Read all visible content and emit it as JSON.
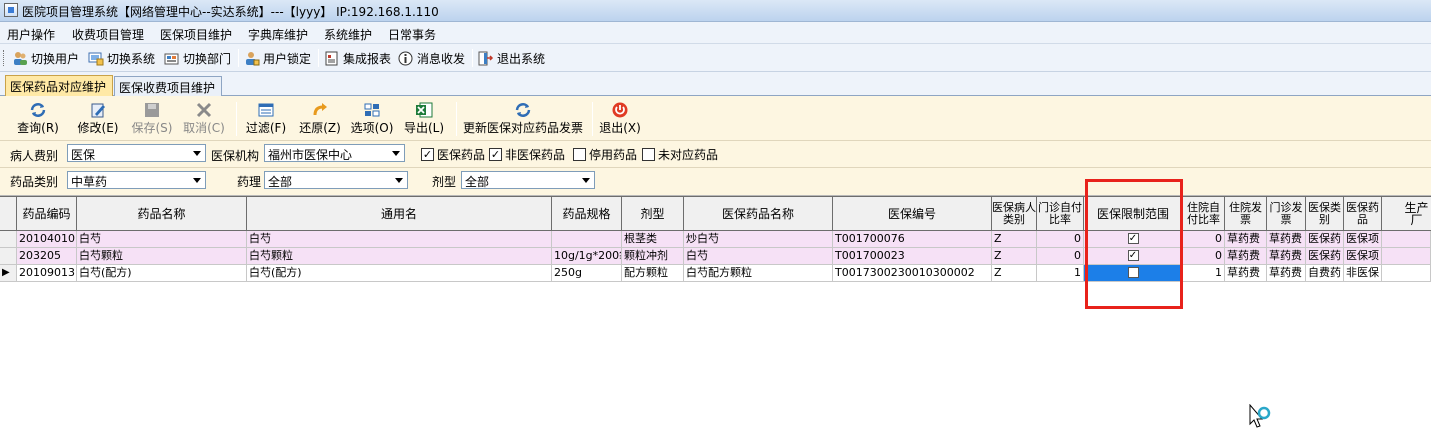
{
  "window": {
    "title": "医院项目管理系统【网络管理中心--实达系统】---【lyyy】 IP:192.168.1.110"
  },
  "menu": [
    "用户操作",
    "收费项目管理",
    "医保项目维护",
    "字典库维护",
    "系统维护",
    "日常事务"
  ],
  "toolbar": [
    {
      "label": "切换用户",
      "icon": "users-icon"
    },
    {
      "label": "切换系统",
      "icon": "switch-system-icon"
    },
    {
      "label": "切换部门",
      "icon": "department-icon"
    },
    {
      "label": "用户锁定",
      "icon": "lock-user-icon"
    },
    {
      "label": "集成报表",
      "icon": "report-icon"
    },
    {
      "label": "消息收发",
      "icon": "info-icon"
    },
    {
      "label": "退出系统",
      "icon": "exit-icon"
    }
  ],
  "tabs": [
    "医保药品对应维护",
    "医保收费项目维护"
  ],
  "actions": [
    {
      "label": "查询(R)",
      "icon": "refresh-icon",
      "enabled": true
    },
    {
      "label": "修改(E)",
      "icon": "edit-icon",
      "enabled": true
    },
    {
      "label": "保存(S)",
      "icon": "save-icon",
      "enabled": false
    },
    {
      "label": "取消(C)",
      "icon": "cancel-icon",
      "enabled": false
    },
    {
      "label": "过滤(F)",
      "icon": "filter-icon",
      "enabled": true
    },
    {
      "label": "还原(Z)",
      "icon": "restore-icon",
      "enabled": true
    },
    {
      "label": "选项(O)",
      "icon": "options-icon",
      "enabled": true
    },
    {
      "label": "导出(L)",
      "icon": "excel-icon",
      "enabled": true
    },
    {
      "label": "更新医保对应药品发票",
      "icon": "update-icon",
      "enabled": true
    },
    {
      "label": "退出(X)",
      "icon": "power-icon",
      "enabled": true
    }
  ],
  "filters": {
    "patient_type_label": "病人费别",
    "patient_type_value": "医保",
    "institution_label": "医保机构",
    "institution_value": "福州市医保中心",
    "checks": [
      {
        "label": "医保药品",
        "checked": true
      },
      {
        "label": "非医保药品",
        "checked": true
      },
      {
        "label": "停用药品",
        "checked": false
      },
      {
        "label": "未对应药品",
        "checked": false
      }
    ],
    "drug_category_label": "药品类别",
    "drug_category_value": "中草药",
    "pharmacology_label": "药理",
    "pharmacology_value": "全部",
    "dosage_form_label": "剂型",
    "dosage_form_value": "全部"
  },
  "grid": {
    "columns": [
      "药品编码",
      "药品名称",
      "通用名",
      "药品规格",
      "剂型",
      "医保药品名称",
      "医保编号",
      "医保病人类别",
      "门诊自付比率",
      "医保限制范围",
      "住院自付比率",
      "住院发票",
      "门诊发票",
      "医保类别",
      "医保药品",
      "生产厂"
    ],
    "rows": [
      {
        "code": "20104010",
        "name": "白芍",
        "generic": "白芍",
        "spec": "",
        "form": "根茎类",
        "yb_name": "炒白芍",
        "yb_no": "T001700076",
        "cat": "Z",
        "op_rate": "0",
        "limit": true,
        "ip_rate": "0",
        "ip_invoice": "草药费",
        "op_invoice": "草药费",
        "yb_type": "医保药",
        "yb_drug": "医保项",
        "maker": "",
        "highlight": true
      },
      {
        "code": "203205",
        "name": "白芍颗粒",
        "generic": "白芍颗粒",
        "spec": "10g/1g*200袋",
        "form": "颗粒冲剂",
        "yb_name": "白芍",
        "yb_no": "T001700023",
        "cat": "Z",
        "op_rate": "0",
        "limit": true,
        "ip_rate": "0",
        "ip_invoice": "草药费",
        "op_invoice": "草药费",
        "yb_type": "医保药",
        "yb_drug": "医保项",
        "maker": "",
        "highlight": true
      },
      {
        "code": "20109013",
        "name": "白芍(配方)",
        "generic": "白芍(配方)",
        "spec": "250g",
        "form": "配方颗粒",
        "yb_name": "白芍配方颗粒",
        "yb_no": "T0017300230010300002",
        "cat": "Z",
        "op_rate": "1",
        "limit": false,
        "ip_rate": "1",
        "ip_invoice": "草药费",
        "op_invoice": "草药费",
        "yb_type": "自费药",
        "yb_drug": "非医保",
        "maker": "",
        "highlight": false
      }
    ]
  },
  "colors": {
    "highlight_border": "#e8221b",
    "row_highlight": "#f6e1f6",
    "panel_bg": "#fdf6e1",
    "active_tab": "#ffe9a6",
    "selected_cell": "#1c7fe8"
  }
}
